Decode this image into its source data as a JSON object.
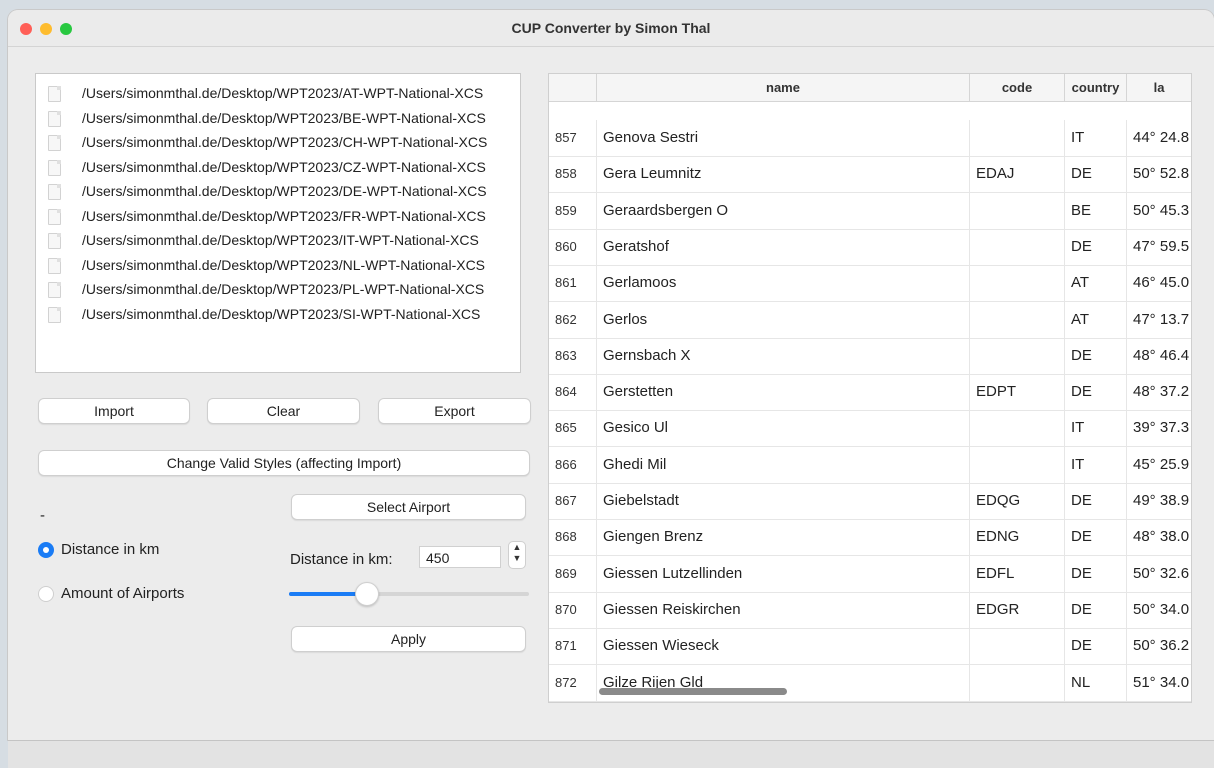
{
  "window": {
    "title": "CUP Converter by Simon Thal"
  },
  "files": [
    "/Users/simonmthal.de/Desktop/WPT2023/AT-WPT-National-XCS",
    "/Users/simonmthal.de/Desktop/WPT2023/BE-WPT-National-XCS",
    "/Users/simonmthal.de/Desktop/WPT2023/CH-WPT-National-XCS",
    "/Users/simonmthal.de/Desktop/WPT2023/CZ-WPT-National-XCS",
    "/Users/simonmthal.de/Desktop/WPT2023/DE-WPT-National-XCS",
    "/Users/simonmthal.de/Desktop/WPT2023/FR-WPT-National-XCS",
    "/Users/simonmthal.de/Desktop/WPT2023/IT-WPT-National-XCS",
    "/Users/simonmthal.de/Desktop/WPT2023/NL-WPT-National-XCS",
    "/Users/simonmthal.de/Desktop/WPT2023/PL-WPT-National-XCS",
    "/Users/simonmthal.de/Desktop/WPT2023/SI-WPT-National-XCS"
  ],
  "buttons": {
    "import": "Import",
    "clear": "Clear",
    "export": "Export",
    "change_styles": "Change Valid Styles (affecting Import)",
    "select_airport": "Select Airport",
    "apply": "Apply"
  },
  "selected_airport": "-",
  "mode": {
    "distance_label": "Distance in km",
    "amount_label": "Amount of Airports",
    "selected": "distance"
  },
  "distance": {
    "label": "Distance in km:",
    "value": "450",
    "slider_fraction": 0.32
  },
  "table": {
    "columns": [
      "",
      "name",
      "code",
      "country",
      "la"
    ],
    "rows": [
      {
        "idx": "857",
        "name": "Genova Sestri",
        "code": "",
        "country": "IT",
        "lat": "44° 24.8"
      },
      {
        "idx": "858",
        "name": "Gera Leumnitz",
        "code": "EDAJ",
        "country": "DE",
        "lat": "50° 52.8"
      },
      {
        "idx": "859",
        "name": "Geraardsbergen O",
        "code": "",
        "country": "BE",
        "lat": "50° 45.3"
      },
      {
        "idx": "860",
        "name": "Geratshof",
        "code": "",
        "country": "DE",
        "lat": "47° 59.5"
      },
      {
        "idx": "861",
        "name": "Gerlamoos",
        "code": "",
        "country": "AT",
        "lat": "46° 45.0"
      },
      {
        "idx": "862",
        "name": "Gerlos",
        "code": "",
        "country": "AT",
        "lat": "47° 13.7"
      },
      {
        "idx": "863",
        "name": "Gernsbach X",
        "code": "",
        "country": "DE",
        "lat": "48° 46.4"
      },
      {
        "idx": "864",
        "name": "Gerstetten",
        "code": "EDPT",
        "country": "DE",
        "lat": "48° 37.2"
      },
      {
        "idx": "865",
        "name": "Gesico Ul",
        "code": "",
        "country": "IT",
        "lat": "39° 37.3"
      },
      {
        "idx": "866",
        "name": "Ghedi Mil",
        "code": "",
        "country": "IT",
        "lat": "45° 25.9"
      },
      {
        "idx": "867",
        "name": "Giebelstadt",
        "code": "EDQG",
        "country": "DE",
        "lat": "49° 38.9"
      },
      {
        "idx": "868",
        "name": "Giengen Brenz",
        "code": "EDNG",
        "country": "DE",
        "lat": "48° 38.0"
      },
      {
        "idx": "869",
        "name": "Giessen Lutzellinden",
        "code": "EDFL",
        "country": "DE",
        "lat": "50° 32.6"
      },
      {
        "idx": "870",
        "name": "Giessen Reiskirchen",
        "code": "EDGR",
        "country": "DE",
        "lat": "50° 34.0"
      },
      {
        "idx": "871",
        "name": "Giessen Wieseck",
        "code": "",
        "country": "DE",
        "lat": "50° 36.2"
      },
      {
        "idx": "872",
        "name": "Gilze Rijen Gld",
        "code": "",
        "country": "NL",
        "lat": "51° 34.0"
      }
    ]
  },
  "colors": {
    "accent": "#1a7cf5",
    "traffic_red": "#ff5f57",
    "traffic_yellow": "#febc2e",
    "traffic_green": "#28c840"
  }
}
